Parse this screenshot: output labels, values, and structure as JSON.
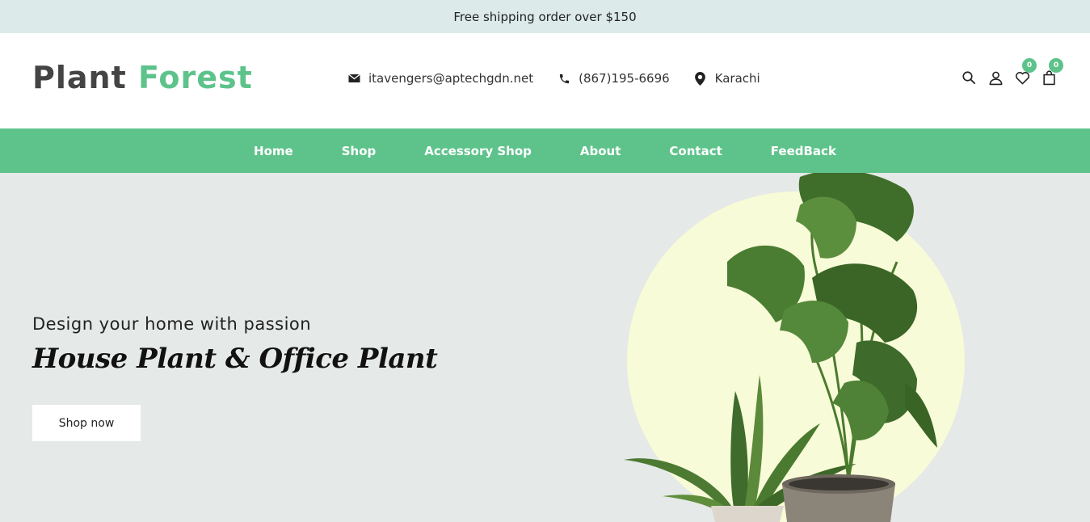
{
  "topbar": {
    "text": "Free shipping order over $150"
  },
  "header": {
    "logo": {
      "part1": "Plant",
      "part2": "Forest"
    },
    "contacts": {
      "email": "itavengers@aptechgdn.net",
      "phone": "(867)195-6696",
      "location": "Karachi"
    },
    "icons": {
      "wishlist_count": "0",
      "cart_count": "0"
    }
  },
  "nav": {
    "items": [
      "Home",
      "Shop",
      "Accessory Shop",
      "About",
      "Contact",
      "FeedBack"
    ]
  },
  "hero": {
    "subtitle": "Design your home with passion",
    "title": "House Plant & Office Plant",
    "button_label": "Shop now"
  },
  "colors": {
    "accent": "#5ec38b",
    "topbar_bg": "#dcebea",
    "hero_bg": "#e5e9e7",
    "circle": "#f8fbd8"
  }
}
